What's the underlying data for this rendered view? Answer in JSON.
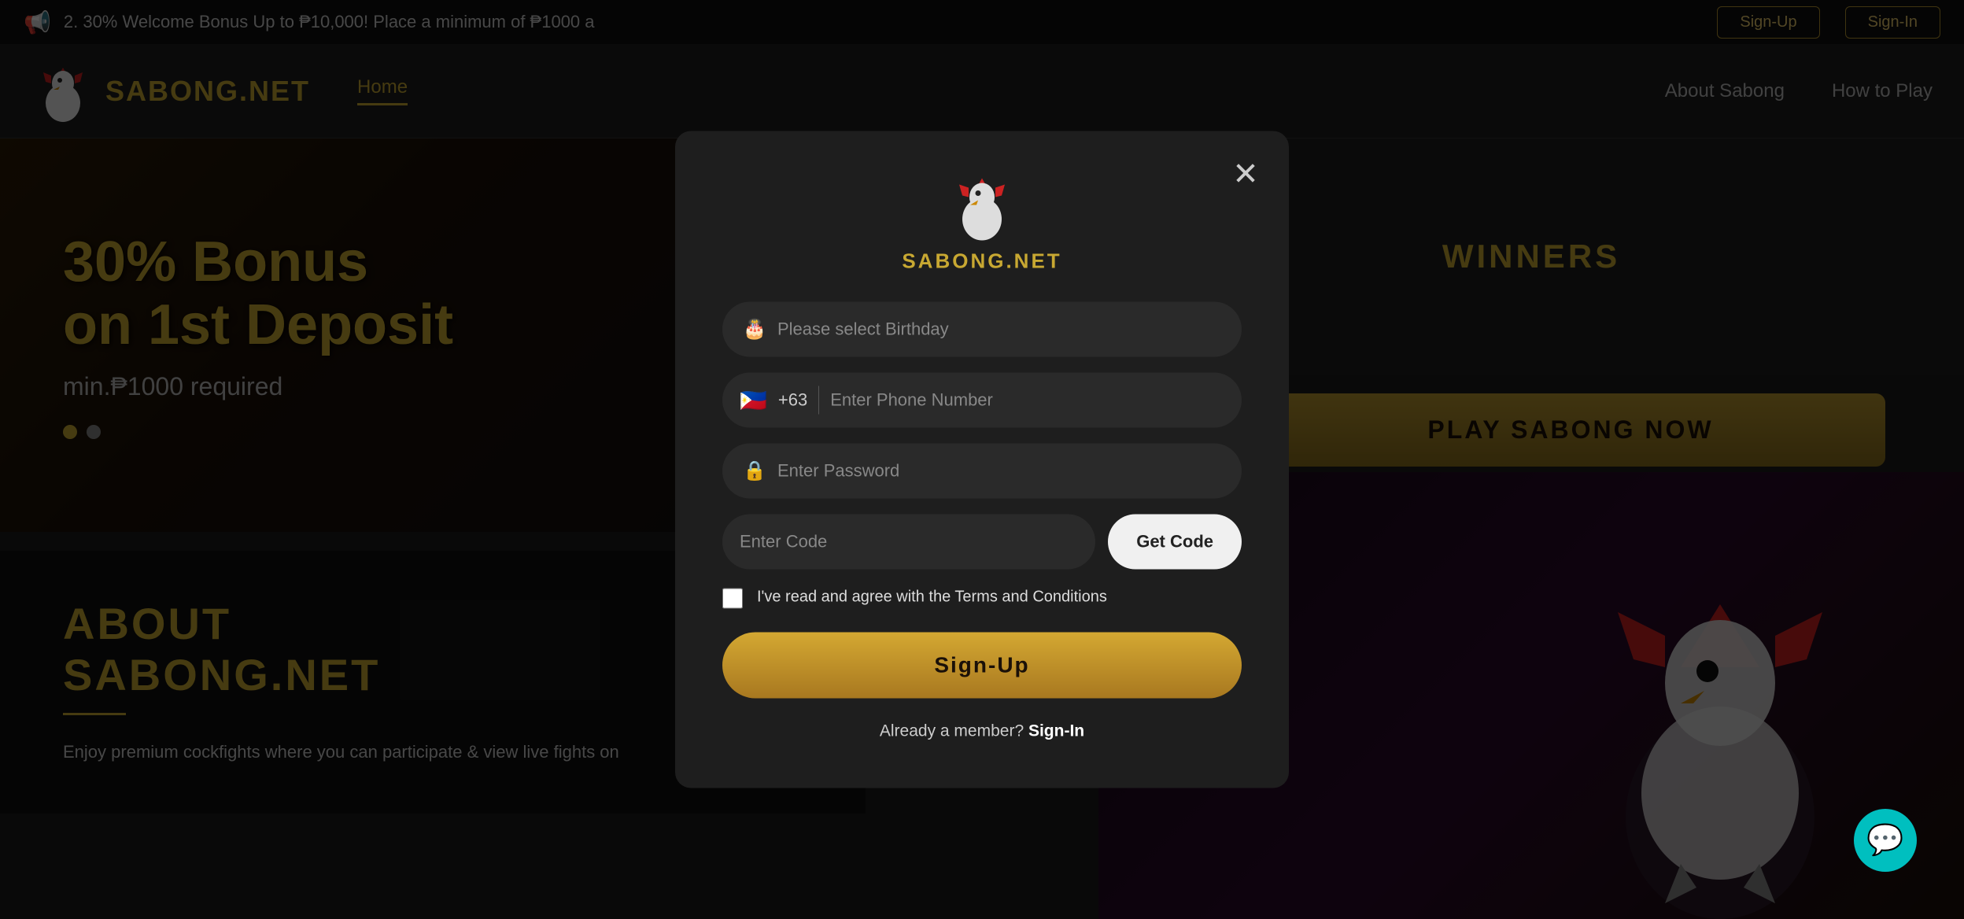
{
  "announcement": {
    "text": "2. 30% Welcome Bonus Up to ₱10,000! Place a minimum of ₱1000 a",
    "signup_label": "Sign-Up",
    "signin_label": "Sign-In"
  },
  "header": {
    "logo_text": "SABONG.NET",
    "nav": {
      "home": "Home",
      "about": "About Sabong",
      "how_to_play": "How to Play"
    }
  },
  "hero": {
    "title_line1": "30% Bonus",
    "title_line2": "on 1st Deposit",
    "subtitle": "min.₱1000 required"
  },
  "about": {
    "title_line1": "ABOUT",
    "title_line2": "SABONG.NET",
    "description": "Enjoy premium cockfights where you can participate & view live fights on"
  },
  "winners": {
    "title": "WINNERS"
  },
  "play_button": {
    "label": "PLAY SABONG NOW"
  },
  "modal": {
    "logo_text": "SABONG.NET",
    "close_icon": "✕",
    "birthday_placeholder": "Please select Birthday",
    "phone_code": "+63",
    "phone_placeholder": "Enter Phone Number",
    "password_placeholder": "Enter Password",
    "code_placeholder": "Enter Code",
    "get_code_label": "Get Code",
    "terms_text": "I've read and agree with the Terms and Conditions",
    "signup_label": "Sign-Up",
    "already_member_text": "Already a member?",
    "signin_label": "Sign-In"
  },
  "chat": {
    "icon": "💬"
  }
}
